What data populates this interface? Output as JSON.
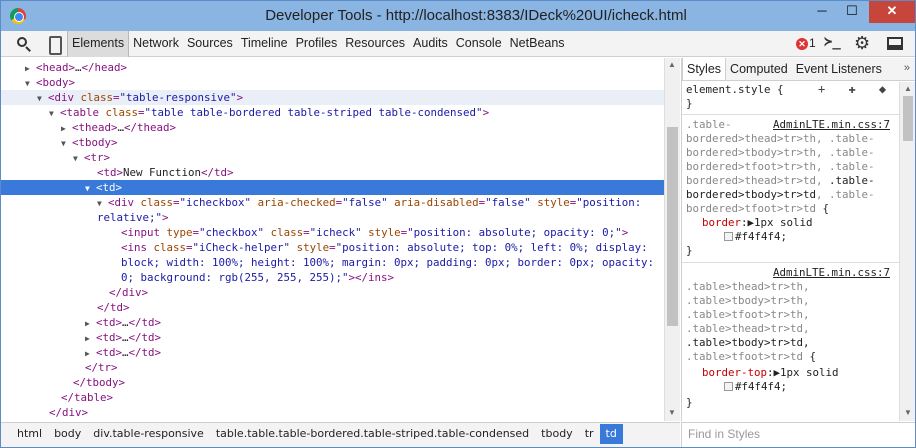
{
  "window": {
    "title": "Developer Tools - http://localhost:8383/IDeck%20UI/icheck.html",
    "min": "─",
    "max": "☐",
    "close": "✕"
  },
  "toolbar": {
    "tabs": [
      "Elements",
      "Network",
      "Sources",
      "Timeline",
      "Profiles",
      "Resources",
      "Audits",
      "Console",
      "NetBeans"
    ],
    "active_tab": "Elements",
    "error_count": "1",
    "console_glyph": "≻_",
    "gear_glyph": "⚙"
  },
  "dom": {
    "l0": {
      "open": "<head>",
      "ellipsis": "…",
      "close": "</head>"
    },
    "l1": {
      "tag": "<body>"
    },
    "l2": {
      "open": "<div ",
      "attr": "class",
      "eq": "=",
      "val": "\"table-responsive\"",
      "end": ">"
    },
    "l3": {
      "open": "<table ",
      "attr": "class",
      "eq": "=",
      "val": "\"table table-bordered table-striped table-condensed\"",
      "end": ">"
    },
    "l4": {
      "open": "<thead>",
      "ellipsis": "…",
      "close": "</thead>"
    },
    "l5": {
      "tag": "<tbody>"
    },
    "l6": {
      "tag": "<tr>"
    },
    "l7": {
      "open": "<td>",
      "text": "New Function",
      "close": "</td>"
    },
    "l8": {
      "tag": "<td>"
    },
    "l9": {
      "open": "<div ",
      "a1": "class",
      "v1": "\"icheckbox\"",
      "a2": "aria-checked",
      "v2": "\"false\"",
      "a3": "aria-disabled",
      "v3": "\"false\"",
      "a4": "style",
      "v4": "\"position:"
    },
    "l10": {
      "val": "relative;\"",
      "end": ">"
    },
    "l11": {
      "open": "<input ",
      "a1": "type",
      "v1": "\"checkbox\"",
      "a2": "class",
      "v2": "\"icheck\"",
      "a3": "style",
      "v3": "\"position: absolute; opacity: 0;\"",
      "end": ">"
    },
    "l12": {
      "open": "<ins ",
      "a1": "class",
      "v1": "\"iCheck-helper\"",
      "a2": "style",
      "v2": "\"position: absolute; top: 0%; left: 0%; display:"
    },
    "l13": {
      "val": "block; width: 100%; height: 100%; margin: 0px; padding: 0px; border: 0px; opacity:"
    },
    "l14": {
      "val": "0; background: rgb(255, 255, 255);\"",
      "end": "></ins>"
    },
    "l15": {
      "tag": "</div>"
    },
    "l16": {
      "tag": "</td>"
    },
    "l17": {
      "open": "<td>",
      "ellipsis": "…",
      "close": "</td>"
    },
    "l18": {
      "open": "<td>",
      "ellipsis": "…",
      "close": "</td>"
    },
    "l19": {
      "open": "<td>",
      "ellipsis": "…",
      "close": "</td>"
    },
    "l20": {
      "tag": "</tr>"
    },
    "l21": {
      "tag": "</tbody>"
    },
    "l22": {
      "tag": "</table>"
    },
    "l23": {
      "tag": "</div>"
    }
  },
  "styles": {
    "tabs": [
      "Styles",
      "Computed",
      "Event Listeners"
    ],
    "active_tab": "Styles",
    "more": "»",
    "element_style": "element.style {",
    "element_style_close": "}",
    "element_icons": "+ ✚ ◆",
    "rule1": {
      "source": "AdminLTE.min.css:7",
      "sel1a": ".table-",
      "sel2a": "bordered>thead>tr>th, ",
      "sel2b": ".table-",
      "sel3a": "bordered>tbody>tr>th, ",
      "sel3b": ".table-",
      "sel4a": "bordered>tfoot>tr>th, ",
      "sel4b": ".table-",
      "sel5a": "bordered>thead>tr>td, ",
      "sel5b": ".table-",
      "sel6a": "bordered>tbody>tr>td",
      "sel6b": ", .table-",
      "sel7a": "bordered>tfoot>tr>td",
      "sel7b": " {",
      "prop": "border",
      "value": "1px solid",
      "color": "#f4f4f4;",
      "close": "}"
    },
    "rule2": {
      "source": "AdminLTE.min.css:7",
      "sel1": ".table>thead>tr>th,",
      "sel2": ".table>tbody>tr>th,",
      "sel3": ".table>tfoot>tr>th,",
      "sel4": ".table>thead>tr>td,",
      "sel5": ".table>tbody>tr>td,",
      "sel6": ".table>tfoot>tr>td",
      "sel6b": " {",
      "prop": "border-top",
      "value": "1px solid",
      "color": "#f4f4f4;",
      "close": "}"
    }
  },
  "breadcrumbs": [
    "html",
    "body",
    "div.table-responsive",
    "table.table.table-bordered.table-striped.table-condensed",
    "tbody",
    "tr",
    "td"
  ],
  "active_crumb": "td",
  "find_placeholder": "Find in Styles"
}
